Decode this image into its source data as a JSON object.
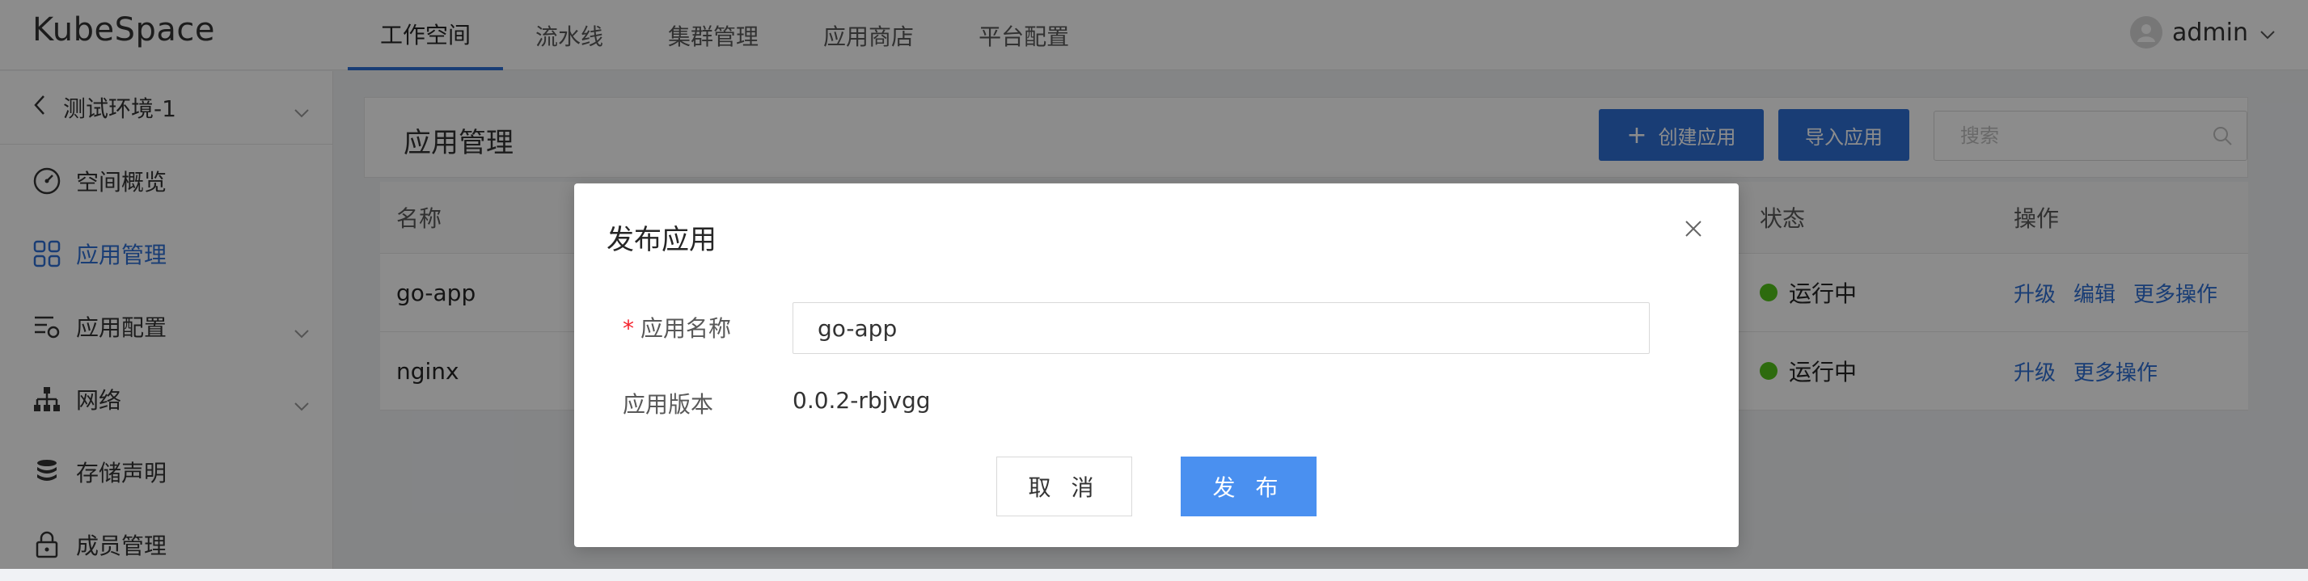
{
  "app": {
    "title": "KubeSpace"
  },
  "nav": {
    "items": [
      {
        "label": "工作空间"
      },
      {
        "label": "流水线"
      },
      {
        "label": "集群管理"
      },
      {
        "label": "应用商店"
      },
      {
        "label": "平台配置"
      }
    ],
    "active_index": 0
  },
  "user": {
    "name": "admin"
  },
  "sidebar": {
    "env": "测试环境-1",
    "items": [
      {
        "label": "空间概览",
        "icon": "dashboard-icon"
      },
      {
        "label": "应用管理",
        "icon": "apps-grid-icon"
      },
      {
        "label": "应用配置",
        "icon": "config-icon"
      },
      {
        "label": "网络",
        "icon": "network-icon"
      },
      {
        "label": "存储声明",
        "icon": "storage-icon"
      },
      {
        "label": "成员管理",
        "icon": "lock-icon"
      }
    ]
  },
  "main": {
    "title": "应用管理",
    "create_label": "创建应用",
    "import_label": "导入应用",
    "search_placeholder": "搜索",
    "columns": {
      "name": "名称",
      "status": "状态",
      "ops": "操作"
    },
    "rows": [
      {
        "name": "go-app",
        "status": "运行中",
        "ops": [
          "升级",
          "编辑",
          "更多操作"
        ]
      },
      {
        "name": "nginx",
        "status": "运行中",
        "ops": [
          "升级",
          "更多操作"
        ]
      }
    ]
  },
  "modal": {
    "title": "发布应用",
    "required_mark": "*",
    "name_label": "应用名称",
    "name_value": "go-app",
    "version_label": "应用版本",
    "version_value": "0.0.2-rbjvgg",
    "cancel_label": "取 消",
    "publish_label": "发 布"
  },
  "colors": {
    "accent": "#2f6fd6",
    "status_running": "#52c41a",
    "publish": "#4a90f0"
  }
}
